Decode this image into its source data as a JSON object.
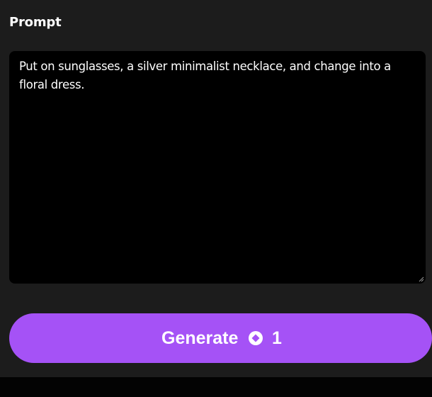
{
  "prompt": {
    "label": "Prompt",
    "text": "Put on sunglasses, a silver minimalist necklace, and change into a floral dress."
  },
  "generate_button": {
    "label": "Generate",
    "credit_icon": "credit-coin-icon",
    "credit_cost": "1"
  },
  "colors": {
    "background": "#1c1c1c",
    "textarea_background": "#000000",
    "accent": "#a552f6",
    "text": "#ffffff"
  }
}
